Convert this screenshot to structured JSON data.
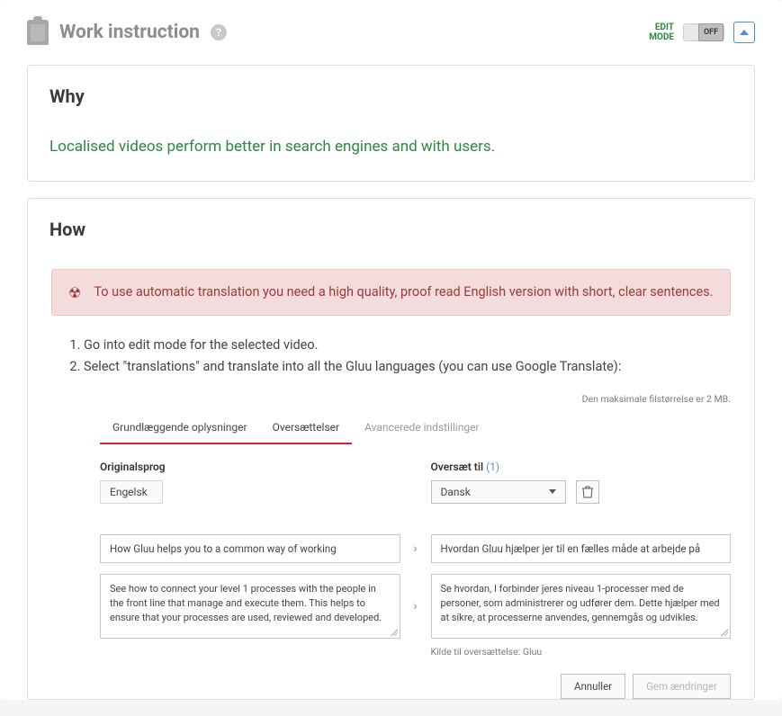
{
  "header": {
    "title": "Work instruction",
    "help_glyph": "?",
    "edit_mode_line1": "EDIT",
    "edit_mode_line2": "MODE",
    "toggle_state": "OFF"
  },
  "why": {
    "heading": "Why",
    "body": "Localised videos perform better in search engines and with users."
  },
  "how": {
    "heading": "How",
    "alert": "To use automatic translation you need a high quality, proof read English version with short, clear sentences.",
    "steps": [
      "Go into edit mode for the selected video.",
      "Select \"translations\" and translate into all the Gluu languages (you can use Google Translate):"
    ]
  },
  "embed": {
    "max_size": "Den maksimale filstørrelse er 2 MB.",
    "tabs": {
      "basic": "Grundlæggende oplysninger",
      "translations": "Oversættelser",
      "advanced": "Avancerede indstillinger"
    },
    "left": {
      "label": "Originalsprog",
      "language": "Engelsk",
      "title_value": "How Gluu helps you to a common way of working",
      "desc_value": "See how to connect your level 1 processes with the people in the front line that manage and execute them. This helps to ensure that your processes are used, reviewed and developed."
    },
    "right": {
      "label": "Oversæt til",
      "count": "(1)",
      "language": "Dansk",
      "title_value": "Hvordan Gluu hjælper jer til en fælles måde at arbejde på",
      "desc_value": "Se hvordan, I forbinder jeres niveau 1-processer med de personer, som administrerer og udfører dem. Dette hjælper med at sikre, at processerne anvendes, gennemgås og udvikles.",
      "source_note": "Kilde til oversættelse: Gluu"
    },
    "buttons": {
      "cancel": "Annuller",
      "save": "Gem ændringer"
    }
  }
}
